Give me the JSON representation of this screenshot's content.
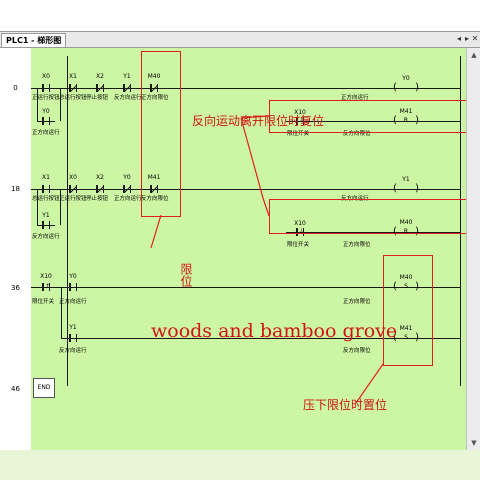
{
  "window": {
    "tab_label": "PLC1 - 梯形图",
    "controls": {
      "prev": "◂",
      "next": "▸",
      "close": "✕"
    },
    "scroll_up": "▲",
    "scroll_down": "▼"
  },
  "steps": [
    "0",
    "18",
    "36",
    "46"
  ],
  "rung0": {
    "contacts": [
      "X0",
      "X1",
      "X2",
      "Y1",
      "M40",
      "Y0"
    ],
    "texts": [
      "正运行按钮",
      "总运行按钮",
      "停止按钮",
      "反方向运行",
      "正方向限位",
      "正方向运行"
    ],
    "coil_label": "Y0",
    "coil_text": "正方向运行",
    "reset_contact": "X10",
    "reset_contact_text": "限位开关",
    "reset_coil_label": "M41",
    "reset_coil_text": "反方向限位",
    "reset_op": "R"
  },
  "rung18": {
    "contacts": [
      "X1",
      "X0",
      "X2",
      "Y0",
      "M41",
      "Y1"
    ],
    "texts": [
      "总运行按钮",
      "正运行按钮",
      "停止按钮",
      "正方向运行",
      "反方向限位",
      "反方向运行"
    ],
    "coil_label": "Y1",
    "coil_text": "反方向运行",
    "reset_contact": "X10",
    "reset_contact_text": "限位开关",
    "reset_coil_label": "M40",
    "reset_coil_text": "正方向限位",
    "reset_op": "R"
  },
  "rung36": {
    "contacts": [
      "X10",
      "Y0",
      "Y1"
    ],
    "texts": [
      "限位开关",
      "正方向运行",
      "反方向运行"
    ],
    "coil1_label": "M40",
    "coil1_text": "正方向限位",
    "coil2_label": "M41",
    "coil2_text": "反方向限位",
    "set_op": "S"
  },
  "end_label": "END",
  "annotations": {
    "limit_reset": "反向运动离开限位时复位",
    "limit": "限位",
    "watermark": "woods and bamboo grove",
    "press_set": "压下限位时置位"
  },
  "colors": {
    "canvas": "#cdf6a4",
    "annotation": "#d01414"
  }
}
